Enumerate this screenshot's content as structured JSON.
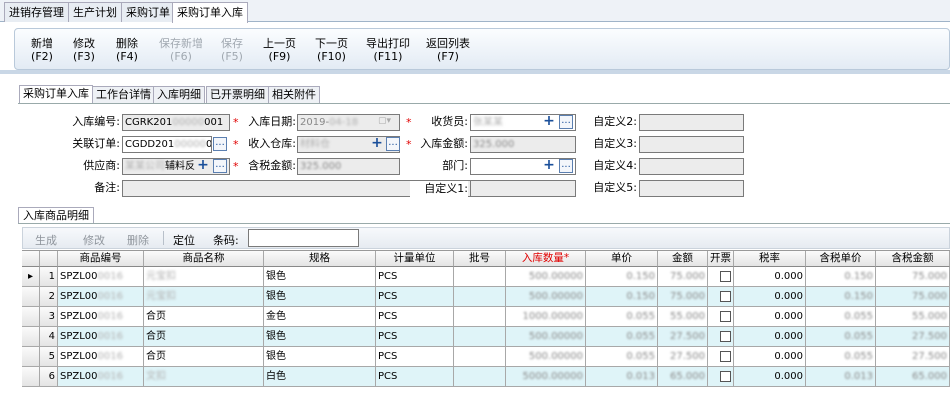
{
  "top_tabs": [
    "进销存管理",
    "生产计划",
    "采购订单",
    "采购订单入库"
  ],
  "toolbar": [
    {
      "label": "新增",
      "key": "(F2)",
      "enabled": true
    },
    {
      "label": "修改",
      "key": "(F3)",
      "enabled": true
    },
    {
      "label": "删除",
      "key": "(F4)",
      "enabled": true
    },
    {
      "label": "保存新增",
      "key": "(F6)",
      "enabled": false
    },
    {
      "label": "保存",
      "key": "(F5)",
      "enabled": false
    },
    {
      "label": "上一页",
      "key": "(F9)",
      "enabled": true
    },
    {
      "label": "下一页",
      "key": "(F10)",
      "enabled": true
    },
    {
      "label": "导出打印",
      "key": "(F11)",
      "enabled": true
    },
    {
      "label": "返回列表",
      "key": "(F7)",
      "enabled": true
    }
  ],
  "sub_tabs": [
    "采购订单入库",
    "工作台详情",
    "入库明细",
    "已开票明细",
    "相关附件"
  ],
  "form": {
    "inbound_no": {
      "label": "入库编号:",
      "value": "CGRK201",
      "value_tail": "001"
    },
    "inbound_date": {
      "label": "入库日期:",
      "value": "2019-",
      "placeholder_tail": "-"
    },
    "receiver": {
      "label": "收货员:",
      "value": "张"
    },
    "custom2": {
      "label": "自定义2:",
      "value": ""
    },
    "linked_order": {
      "label": "关联订单:",
      "value": "CGDD201",
      "value_tail": "009"
    },
    "warehouse": {
      "label": "收入仓库:",
      "value": "材"
    },
    "inbound_amount": {
      "label": "入库金额:",
      "value": "325.000"
    },
    "custom3": {
      "label": "自定义3:",
      "value": ""
    },
    "supplier": {
      "label": "供应商:",
      "value": "",
      "value_tail": "辅料",
      "value_tail2": "反"
    },
    "tax_amount": {
      "label": "含税金额:",
      "value": "325.000"
    },
    "department": {
      "label": "部门:",
      "value": ""
    },
    "custom4": {
      "label": "自定义4:",
      "value": ""
    },
    "remark": {
      "label": "备注:",
      "value": ""
    },
    "custom1": {
      "label": "自定义1:",
      "value": ""
    },
    "custom5": {
      "label": "自定义5:",
      "value": ""
    }
  },
  "detail": {
    "tab": "入库商品明细",
    "buttons": [
      {
        "label": "生成",
        "enabled": false
      },
      {
        "label": "修改",
        "enabled": false
      },
      {
        "label": "删除",
        "enabled": false
      },
      {
        "label": "定位",
        "enabled": true
      }
    ],
    "barcode_label": "条码:",
    "barcode_value": ""
  },
  "table": {
    "columns": [
      "商品编号",
      "商品名称",
      "规格",
      "计量单位",
      "批号",
      "入库数量*",
      "单价",
      "金额",
      "开票",
      "税率",
      "含税单价",
      "含税金额"
    ],
    "rows": [
      {
        "n": "1",
        "code": "SPZL00",
        "name": "元宝",
        "spec": "银色",
        "unit": "PCS",
        "batch": "",
        "qty": "500.00000",
        "price": "0.150",
        "amount": "75.000",
        "tax": "0.000",
        "tprice": "0.150",
        "tamount": "75.000"
      },
      {
        "n": "2",
        "code": "SPZL00",
        "name": "元宝",
        "spec": "银色",
        "unit": "PCS",
        "batch": "",
        "qty": "500.00000",
        "price": "0.150",
        "amount": "75.000",
        "tax": "0.000",
        "tprice": "0.150",
        "tamount": "75.000"
      },
      {
        "n": "3",
        "code": "SPZL00",
        "name": "合页",
        "spec": "金色",
        "unit": "PCS",
        "batch": "",
        "qty": "1000.00000",
        "price": "0.055",
        "amount": "55.000",
        "tax": "0.000",
        "tprice": "0.055",
        "tamount": "55.000"
      },
      {
        "n": "4",
        "code": "SPZL00",
        "name": "合页",
        "spec": "银色",
        "unit": "PCS",
        "batch": "",
        "qty": "500.00000",
        "price": "0.055",
        "amount": "27.500",
        "tax": "0.000",
        "tprice": "0.055",
        "tamount": "27.500"
      },
      {
        "n": "5",
        "code": "SPZL00",
        "name": "合页",
        "spec": "银色",
        "unit": "PCS",
        "batch": "",
        "qty": "500.00000",
        "price": "0.055",
        "amount": "27.500",
        "tax": "0.000",
        "tprice": "0.055",
        "tamount": "27.500"
      },
      {
        "n": "6",
        "code": "SPZL00",
        "name": "文",
        "spec": "白色",
        "unit": "PCS",
        "batch": "",
        "qty": "5000.00000",
        "price": "0.013",
        "amount": "65.000",
        "tax": "0.000",
        "tprice": "0.013",
        "tamount": "65.000"
      }
    ]
  },
  "colors": {
    "row_alt": "#dff4f8",
    "required": "#e00000",
    "header_gradient_end": "#e4e4e4"
  }
}
